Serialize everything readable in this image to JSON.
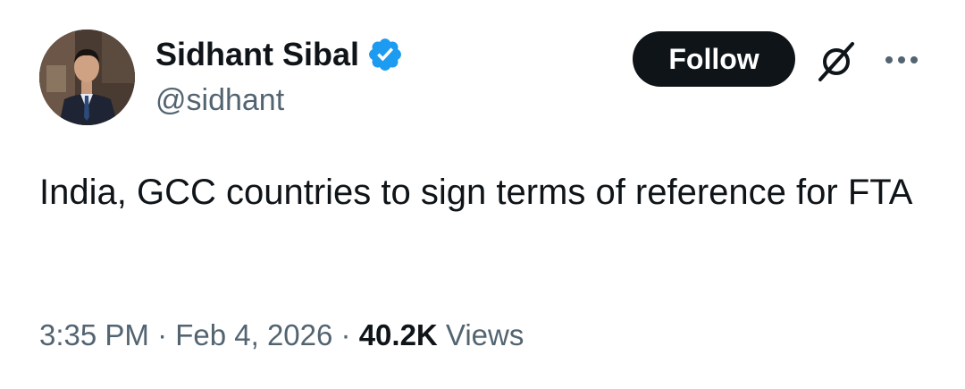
{
  "author": {
    "display_name": "Sidhant Sibal",
    "handle": "@sidhant",
    "verified": true
  },
  "actions": {
    "follow_label": "Follow",
    "grok_icon": "grok-icon",
    "more_icon": "more-options-icon"
  },
  "tweet": {
    "text": "India, GCC countries to sign terms of reference for FTA"
  },
  "meta": {
    "time": "3:35 PM",
    "separator_1": " · ",
    "date": "Feb 4, 2026",
    "separator_2": " · ",
    "views_count": "40.2K",
    "views_label": " Views"
  },
  "colors": {
    "text_primary": "#0f1419",
    "text_secondary": "#536471",
    "verified_blue": "#1d9bf0",
    "follow_bg": "#0f1419"
  }
}
